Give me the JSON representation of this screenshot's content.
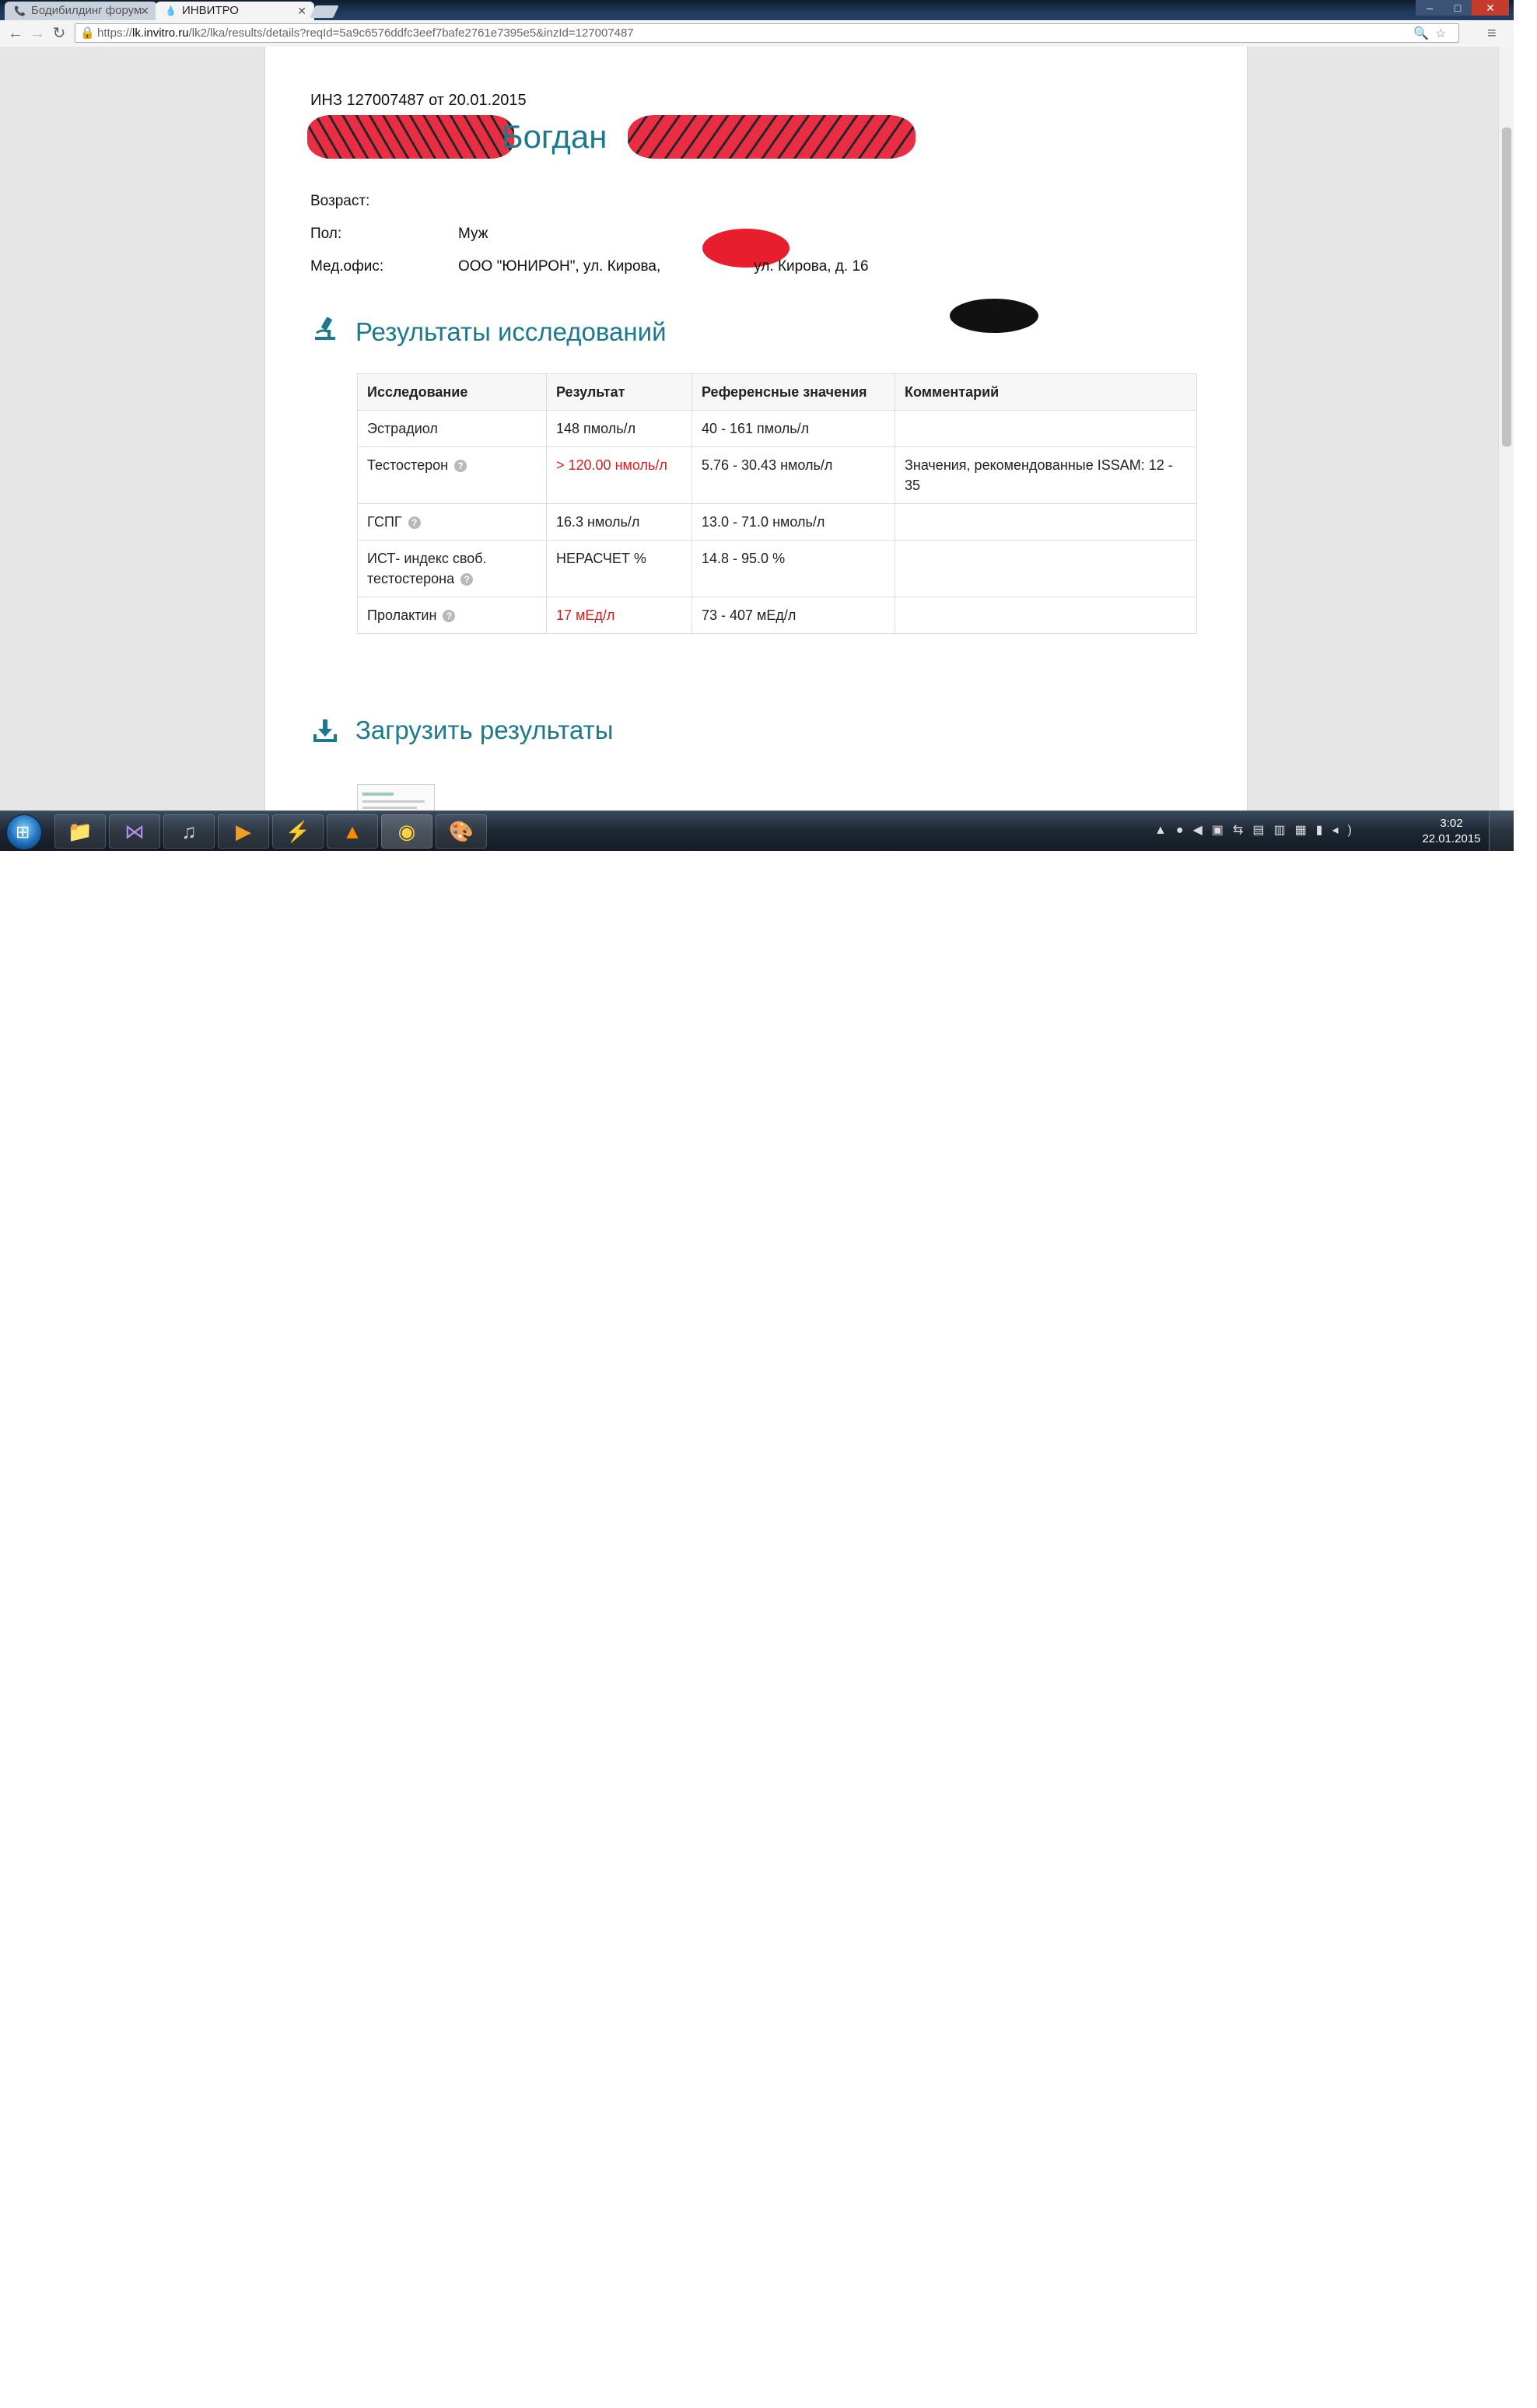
{
  "browser": {
    "tabs": [
      {
        "label": "Бодибилдинг форум",
        "icon": "forum-icon",
        "active": false
      },
      {
        "label": "ИНВИТРО",
        "icon": "invitro-drop-icon",
        "active": true
      }
    ],
    "url_scheme": "https://",
    "url_host": "lk.invitro.ru",
    "url_path": "/lk2/lka/results/details?reqId=5a9c6576ddfc3eef7bafe2761e7395e5&inzId=127007487",
    "window_controls": {
      "minimize": "–",
      "maximize": "□",
      "close": "✕"
    }
  },
  "page": {
    "inz_line": "ИНЗ 127007487 от 20.01.2015",
    "patient_first_name": "Богдан",
    "info": [
      {
        "label": "Возраст:",
        "value": ""
      },
      {
        "label": "Пол:",
        "value": "Муж"
      },
      {
        "label": "Мед.офис:",
        "value_part1": "ООО \"ЮНИРОН\", ул. Кирова,",
        "value_part2": "ул. Кирова, д. 16"
      }
    ],
    "results_title": "Результаты исследований",
    "table": {
      "headers": [
        "Исследование",
        "Результат",
        "Референсные значения",
        "Комментарий"
      ],
      "rows": [
        {
          "name": "Эстрадиол",
          "result": "148 пмоль/л",
          "ref": "40 - 161 пмоль/л",
          "comment": "",
          "out_of_range": false,
          "help": false
        },
        {
          "name": "Тестостерон",
          "result": "> 120.00 нмоль/л",
          "ref": "5.76 - 30.43 нмоль/л",
          "comment": "Значения, рекомендованные ISSAM: 12 - 35",
          "out_of_range": true,
          "help": true
        },
        {
          "name": "ГСПГ",
          "result": "16.3 нмоль/л",
          "ref": "13.0 - 71.0 нмоль/л",
          "comment": "",
          "out_of_range": false,
          "help": true
        },
        {
          "name": "ИСТ- индекс своб. тестостерона",
          "result": "НЕРАСЧЕТ %",
          "ref": "14.8 - 95.0 %",
          "comment": "",
          "out_of_range": false,
          "help": true
        },
        {
          "name": "Пролактин",
          "result": "17 мЕд/л",
          "ref": "73 - 407 мЕд/л",
          "comment": "",
          "out_of_range": true,
          "help": true
        }
      ]
    },
    "download_title": "Загрузить результаты"
  },
  "taskbar": {
    "apps": [
      "explorer-icon",
      "visual-studio-icon",
      "audio-player-icon",
      "media-player-icon",
      "download-manager-icon",
      "vlc-icon",
      "chrome-icon",
      "paint-icon"
    ],
    "clock_time": "3:02",
    "clock_date": "22.01.2015"
  },
  "colors": {
    "accent": "#1c7a8c",
    "out_of_range": "#d61f1f"
  }
}
